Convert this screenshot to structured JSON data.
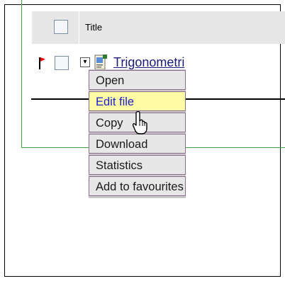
{
  "header": {
    "title_label": "Title"
  },
  "row": {
    "title": "Trigonometri"
  },
  "context_menu": {
    "items": [
      {
        "label": "Open"
      },
      {
        "label": "Edit file"
      },
      {
        "label": "Copy"
      },
      {
        "label": "Download"
      },
      {
        "label": "Statistics"
      },
      {
        "label": "Add to favourites"
      }
    ],
    "highlighted_item": "Edit file"
  },
  "colors": {
    "flag": "#ff0000",
    "highlight_bg": "#fdfba6",
    "highlight_text": "#1b1fce",
    "border_green": "#3fa43f"
  },
  "icons": {
    "flag": "flag-icon",
    "expand": "expand-toggle-icon",
    "document": "document-icon",
    "cursor": "hand-pointer-icon"
  }
}
